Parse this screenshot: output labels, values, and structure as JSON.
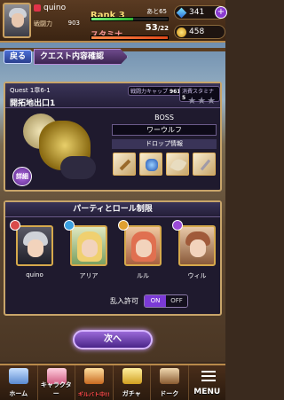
{
  "header": {
    "player_name": "quino",
    "power_label": "戦闘力",
    "power_value": "903",
    "rank_label": "Rank 3",
    "rank_next_label": "あと65",
    "rank_progress": 0.55,
    "stamina_label": "スタミナ",
    "stamina_current": "53",
    "stamina_max": "/22",
    "gems": "341",
    "coins": "458"
  },
  "nav": {
    "back_label": "戻る",
    "page_title": "クエスト内容確認"
  },
  "quest": {
    "id": "Quest 1章6-1",
    "name": "開拓地出口1",
    "cap_label": "戦闘力キャップ",
    "cap_value": "961",
    "stamina_label": "消費スタミナ",
    "stamina_value": "5",
    "stars": "★★★",
    "detail_label": "詳細",
    "boss_label": "BOSS",
    "boss_name": "ワーウルフ",
    "drop_label": "ドロップ情報",
    "drop_icons": [
      "arrows-icon",
      "blue-gem-icon",
      "feather-icon",
      "staff-icon"
    ]
  },
  "party": {
    "title": "パーティとロール制限",
    "members": [
      {
        "name": "quino",
        "role_color": "#d94a4a"
      },
      {
        "name": "アリア",
        "role_color": "#3aa0e0"
      },
      {
        "name": "ルル",
        "role_color": "#e0a030"
      },
      {
        "name": "ウィル",
        "role_color": "#9a4ad6"
      }
    ],
    "intrusion_label": "乱入許可",
    "toggle_on": "ON",
    "toggle_off": "OFF"
  },
  "next_button": "次へ",
  "bottom_nav": [
    {
      "label": "ホーム"
    },
    {
      "label": "キャラクター"
    },
    {
      "label": "ギルバト中!!"
    },
    {
      "label": "ガチャ"
    },
    {
      "label": "ドーク"
    },
    {
      "label": "MENU"
    }
  ],
  "colors": {
    "accent_purple": "#7b3ad6",
    "frame_gold": "#c8a56a"
  }
}
